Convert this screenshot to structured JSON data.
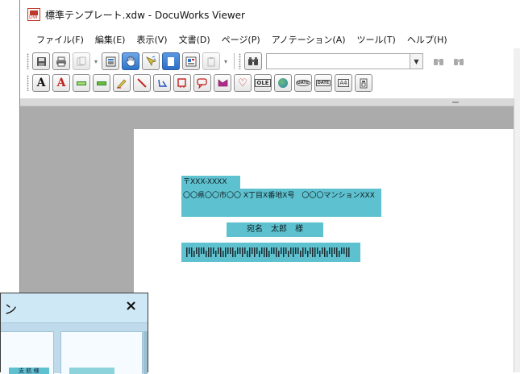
{
  "window": {
    "title": "標準テンプレート.xdw - DocuWorks Viewer"
  },
  "menu": {
    "items": [
      {
        "label": "ファイル(F)"
      },
      {
        "label": "編集(E)"
      },
      {
        "label": "表示(V)"
      },
      {
        "label": "文書(D)"
      },
      {
        "label": "ページ(P)"
      },
      {
        "label": "アノテーション(A)"
      },
      {
        "label": "ツール(T)"
      },
      {
        "label": "ヘルプ(H)"
      }
    ]
  },
  "toolbar1": {
    "icons": [
      "save-icon",
      "print-icon",
      "copy-icon",
      "view-icon",
      "hand-icon",
      "select-icon",
      "page-icon",
      "image-icon",
      "clipboard-icon",
      "binoculars-icon",
      "find-prev-icon",
      "find-next-icon"
    ],
    "search_value": ""
  },
  "toolbar2": {
    "icons": [
      "text-annotation-icon",
      "text-red-annotation-icon",
      "highlighter-icon",
      "highlighter-green-icon",
      "marker-icon",
      "line-icon",
      "polyline-icon",
      "rectangle-icon",
      "callout-icon",
      "stamp-icon",
      "heart-icon",
      "ole-icon",
      "globe-icon",
      "date-icon",
      "date2-icon",
      "a4-icon",
      "page-layout-icon"
    ],
    "labels": {
      "text_a": "A",
      "text_a_red": "A",
      "ole": "OLE",
      "date1": "DATE",
      "date2": "DATE",
      "a4": "A4"
    }
  },
  "document": {
    "zip": "〒XXX-XXXX",
    "address": "〇〇県〇〇市〇〇 X丁目X番地X号　〇〇〇マンションXXX",
    "recipient": "宛名　太郎　様"
  },
  "dialog": {
    "title": "ン",
    "close_label": "×",
    "thumb_text": "支 航 様"
  },
  "colors": {
    "annotation_fill": "#5ec1cf",
    "workspace_bg": "#ababab",
    "dialog_bg": "#cfe8f5",
    "active_button": "#2f74c8"
  }
}
